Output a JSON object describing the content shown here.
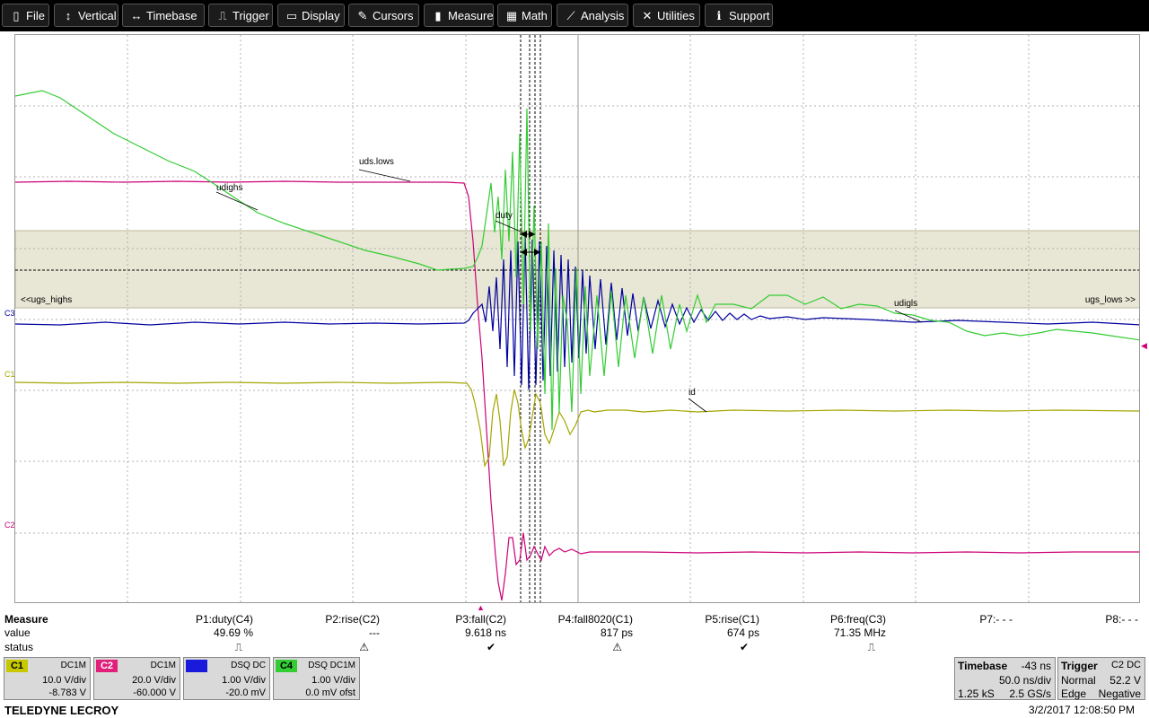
{
  "menu": [
    {
      "label": "File",
      "icon": "file-icon",
      "glyph": "▯"
    },
    {
      "label": "Vertical",
      "icon": "vertical-arrows-icon",
      "glyph": "↕"
    },
    {
      "label": "Timebase",
      "icon": "horizontal-arrows-icon",
      "glyph": "↔"
    },
    {
      "label": "Trigger",
      "icon": "trigger-icon",
      "glyph": "⎍"
    },
    {
      "label": "Display",
      "icon": "display-icon",
      "glyph": "▭"
    },
    {
      "label": "Cursors",
      "icon": "cursors-icon",
      "glyph": "✎"
    },
    {
      "label": "Measure",
      "icon": "measure-icon",
      "glyph": "▮"
    },
    {
      "label": "Math",
      "icon": "calculator-icon",
      "glyph": "▦"
    },
    {
      "label": "Analysis",
      "icon": "analysis-chart-icon",
      "glyph": "⟋"
    },
    {
      "label": "Utilities",
      "icon": "utilities-icon",
      "glyph": "✕"
    },
    {
      "label": "Support",
      "icon": "info-icon",
      "glyph": "ℹ"
    }
  ],
  "waveform_labels": {
    "uds_lows": "uds.lows",
    "udighs": "udighs",
    "duty": "duty",
    "ugs_highs": "<<ugs_highs",
    "ugs_lows": "ugs_lows >>",
    "udigls": "udigls",
    "id": "id"
  },
  "channel_markers": {
    "c1": "C1",
    "c2": "C2",
    "c3": "C3"
  },
  "measure": {
    "title": "Measure",
    "row_labels": [
      "value",
      "status"
    ],
    "params": [
      {
        "name": "P1:duty(C4)",
        "value": "49.69 %",
        "status": "⎍"
      },
      {
        "name": "P2:rise(C2)",
        "value": "---",
        "status": "⚠"
      },
      {
        "name": "P3:fall(C2)",
        "value": "9.618 ns",
        "status": "✔"
      },
      {
        "name": "P4:fall8020(C1)",
        "value": "817 ps",
        "status": "⚠"
      },
      {
        "name": "P5:rise(C1)",
        "value": "674 ps",
        "status": "✔"
      },
      {
        "name": "P6:freq(C3)",
        "value": "71.35 MHz",
        "status": "⎍"
      },
      {
        "name": "P7:- - -",
        "value": "",
        "status": ""
      },
      {
        "name": "P8:- - -",
        "value": "",
        "status": ""
      }
    ]
  },
  "channels": [
    {
      "tag": "C1",
      "coupling": "DC1M",
      "vdiv": "10.0 V/div",
      "offset": "-8.783 V",
      "color": "#c8c800",
      "text": "#000"
    },
    {
      "tag": "C2",
      "coupling": "DC1M",
      "vdiv": "20.0 V/div",
      "offset": "-60.000 V",
      "color": "#e0207a",
      "text": "#fff"
    },
    {
      "tag": "C3",
      "coupling": "DSQ  DC",
      "vdiv": "1.00 V/div",
      "offset": "-20.0 mV",
      "color": "#1a1adc",
      "text": "#1a1adc"
    },
    {
      "tag": "C4",
      "coupling": "DSQ  DC1M",
      "vdiv": "1.00 V/div",
      "offset": "0.0 mV ofst",
      "color": "#33cc33",
      "text": "#000"
    }
  ],
  "timebase": {
    "title": "Timebase",
    "delay": "-43 ns",
    "div": "50.0 ns/div",
    "samples": "1.25 kS",
    "rate": "2.5 GS/s"
  },
  "trigger": {
    "title": "Trigger",
    "source": "C2  DC",
    "mode": "Normal",
    "level": "52.2 V",
    "type": "Edge",
    "slope": "Negative"
  },
  "footer": {
    "brand": "TELEDYNE LECROY",
    "datetime": "3/2/2017 12:08:50 PM"
  },
  "colors": {
    "c1": "#a5a500",
    "c2": "#cc0077",
    "c3": "#0000a0",
    "c4": "#33cc33"
  }
}
